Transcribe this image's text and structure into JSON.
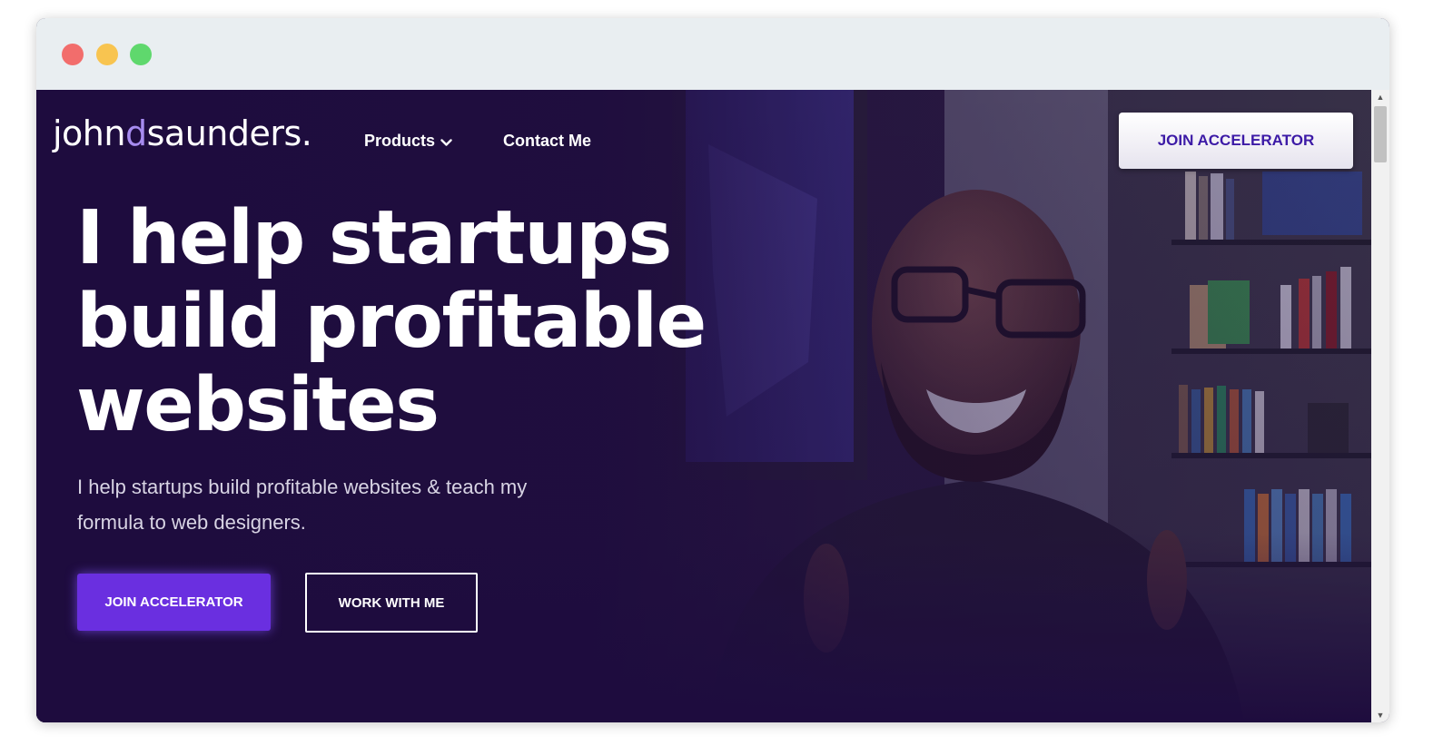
{
  "nav": {
    "logo_part1": "john",
    "logo_accent": "d",
    "logo_part2": "saunders.",
    "products_label": "Products",
    "contact_label": "Contact Me",
    "cta_label": "JOIN ACCELERATOR"
  },
  "hero": {
    "headline_line1": "I help startups",
    "headline_line2": "build profitable",
    "headline_line3": "websites",
    "subtitle": "I help startups build profitable websites & teach my formula to web designers.",
    "primary_button": "JOIN ACCELERATOR",
    "secondary_button": "WORK WITH ME"
  },
  "colors": {
    "brand_purple": "#6a2fe0",
    "logo_accent": "#a78cf0",
    "hero_bg": "#1c0c38"
  },
  "icons": {
    "products_dropdown": "chevron-down-icon",
    "scroll_up": "scroll-up-arrow",
    "scroll_down": "scroll-down-arrow"
  }
}
